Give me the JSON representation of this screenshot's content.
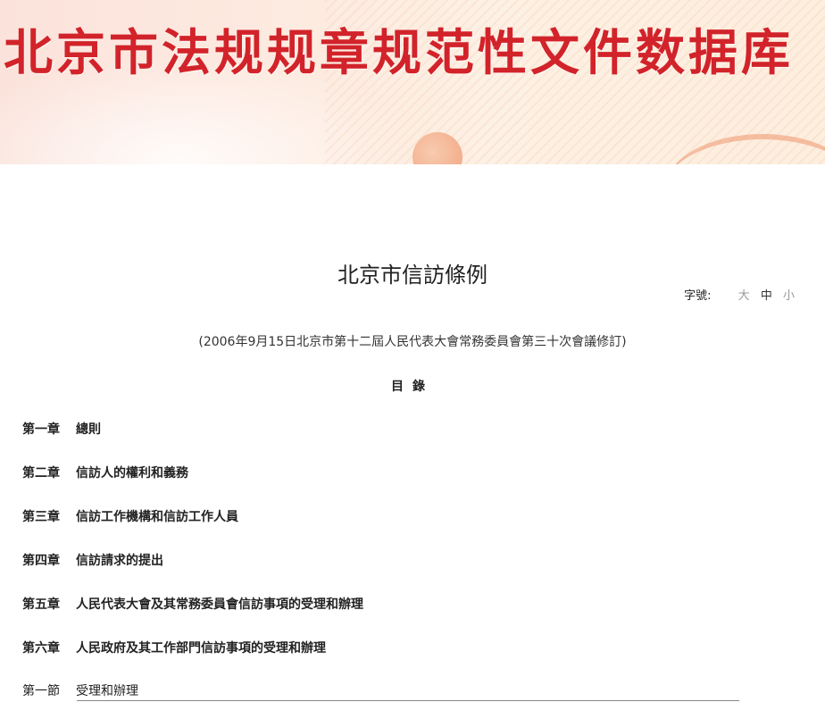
{
  "banner": {
    "title": "北京市法规规章规范性文件数据库"
  },
  "document": {
    "title": "北京市信訪條例",
    "font_size_label": "字號:",
    "font_size_options": [
      "大",
      "中",
      "小"
    ],
    "subtitle": "(2006年9月15日北京市第十二屆人民代表大會常務委員會第三十次會議修訂)",
    "toc_heading": "目錄",
    "toc": [
      {
        "num": "第一章",
        "title": "總則"
      },
      {
        "num": "第二章",
        "title": "信訪人的權利和義務"
      },
      {
        "num": "第三章",
        "title": "信訪工作機構和信訪工作人員"
      },
      {
        "num": "第四章",
        "title": "信訪請求的提出"
      },
      {
        "num": "第五章",
        "title": "人民代表大會及其常務委員會信訪事項的受理和辦理"
      },
      {
        "num": "第六章",
        "title": "人民政府及其工作部門信訪事項的受理和辦理"
      },
      {
        "num": "第一節",
        "title": "受理和辦理"
      }
    ]
  }
}
